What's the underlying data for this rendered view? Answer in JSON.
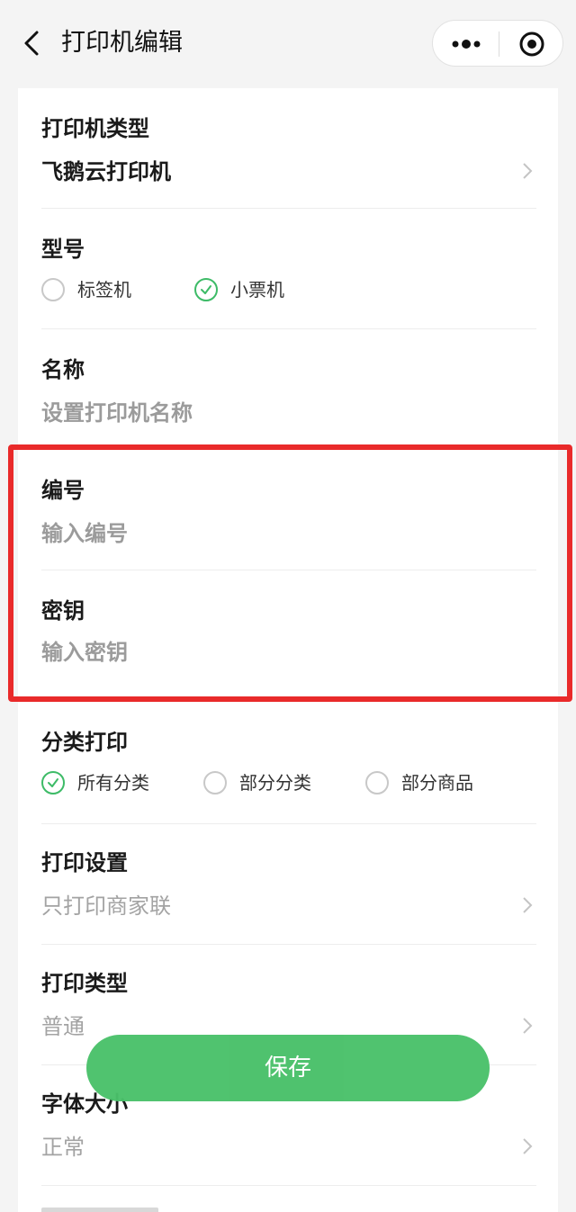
{
  "navbar": {
    "title": "打印机编辑"
  },
  "form": {
    "printer_type": {
      "label": "打印机类型",
      "value": "飞鹅云打印机"
    },
    "model": {
      "label": "型号",
      "options": [
        "标签机",
        "小票机"
      ],
      "selected": "小票机"
    },
    "name": {
      "label": "名称",
      "placeholder": "设置打印机名称"
    },
    "serial": {
      "label": "编号",
      "placeholder": "输入编号"
    },
    "secret": {
      "label": "密钥",
      "placeholder": "输入密钥"
    },
    "category_print": {
      "label": "分类打印",
      "options": [
        "所有分类",
        "部分分类",
        "部分商品"
      ],
      "selected": "所有分类"
    },
    "print_settings": {
      "label": "打印设置",
      "value": "只打印商家联"
    },
    "print_type": {
      "label": "打印类型",
      "value": "普通"
    },
    "font_size": {
      "label": "字体大小",
      "value": "正常"
    }
  },
  "save_button": {
    "label": "保存"
  },
  "colors": {
    "accent": "#4ac16a",
    "check": "#3dbb67",
    "highlight": "#e92a2a"
  }
}
